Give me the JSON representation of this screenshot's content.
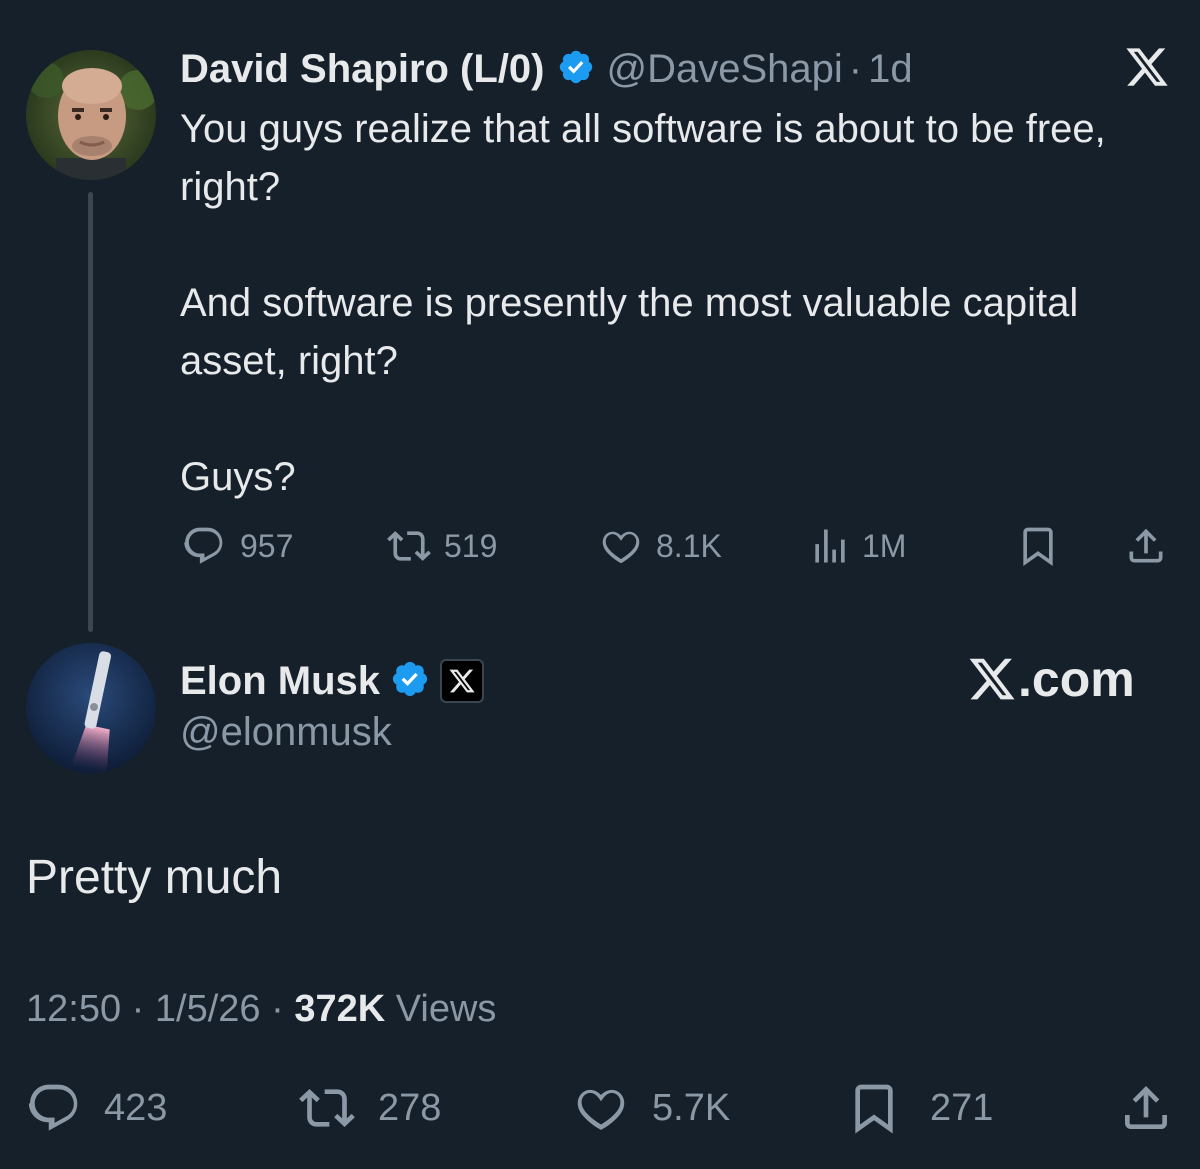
{
  "quoted_post": {
    "author_name": "David Shapiro (L/0)",
    "author_handle": "@DaveShapi",
    "separator": "·",
    "age": "1d",
    "paragraphs": [
      "You guys realize that all software is about to be free, right?",
      "And software is presently the most valuable capital asset, right?",
      "Guys?"
    ],
    "stats": {
      "replies": "957",
      "reposts": "519",
      "likes": "8.1K",
      "views": "1M"
    }
  },
  "main_post": {
    "author_name": "Elon Musk",
    "author_handle": "@elonmusk",
    "text": "Pretty much",
    "time": "12:50",
    "date": "1/5/26",
    "dot": "·",
    "views_count": "372K",
    "views_label": "Views",
    "stats": {
      "replies": "423",
      "reposts": "278",
      "likes": "5.7K",
      "bookmarks": "271"
    }
  },
  "watermark": "X.com",
  "icons": [
    "x-logo-icon",
    "verified-badge-icon",
    "reply-icon",
    "repost-icon",
    "like-icon",
    "views-icon",
    "bookmark-icon",
    "share-icon",
    "affiliate-x-badge-icon"
  ],
  "colors": {
    "background": "#15202b",
    "text": "#e7e9ea",
    "muted": "#8b98a5",
    "verified": "#1d9bf0",
    "thread_line": "#3b4650"
  }
}
